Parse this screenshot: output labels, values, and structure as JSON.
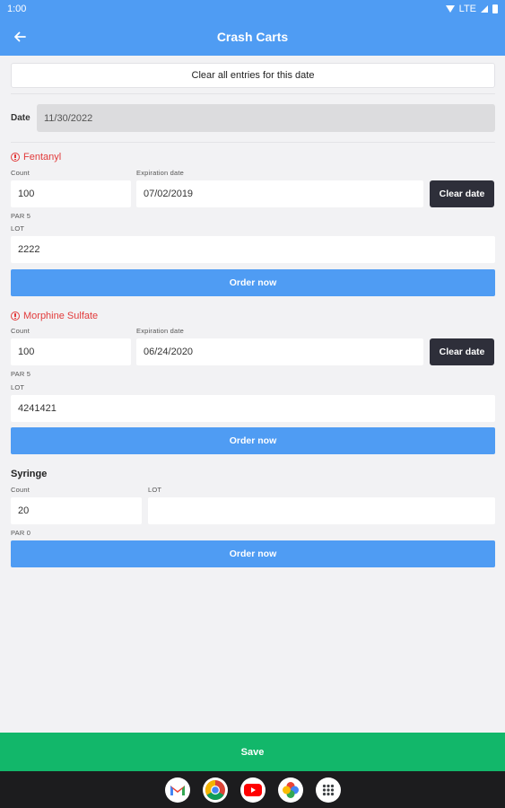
{
  "status": {
    "time": "1:00",
    "network": "LTE"
  },
  "appbar": {
    "title": "Crash Carts"
  },
  "clear_all_label": "Clear all entries for this date",
  "date": {
    "label": "Date",
    "value": "11/30/2022"
  },
  "items": [
    {
      "name": "Fentanyl",
      "count_label": "Count",
      "count": "100",
      "expiration_label": "Expiration date",
      "expiration": "07/02/2019",
      "clear_date_label": "Clear date",
      "par": "PAR 5",
      "lot_label": "LOT",
      "lot": "2222",
      "order_label": "Order now"
    },
    {
      "name": "Morphine Sulfate",
      "count_label": "Count",
      "count": "100",
      "expiration_label": "Expiration date",
      "expiration": "06/24/2020",
      "clear_date_label": "Clear date",
      "par": "PAR 5",
      "lot_label": "LOT",
      "lot": "4241421",
      "order_label": "Order now"
    },
    {
      "name": "Syringe",
      "count_label": "Count",
      "count": "20",
      "lot_label": "LOT",
      "lot": "",
      "par": "PAR 0",
      "order_label": "Order now"
    }
  ],
  "save_label": "Save",
  "colors": {
    "primary": "#4f9cf3",
    "save": "#12b76a",
    "warning": "#e23b3b",
    "dark_button": "#2e2f3a"
  },
  "dock_icons": [
    "gmail-icon",
    "chrome-icon",
    "youtube-icon",
    "photos-icon",
    "app-drawer-icon"
  ]
}
